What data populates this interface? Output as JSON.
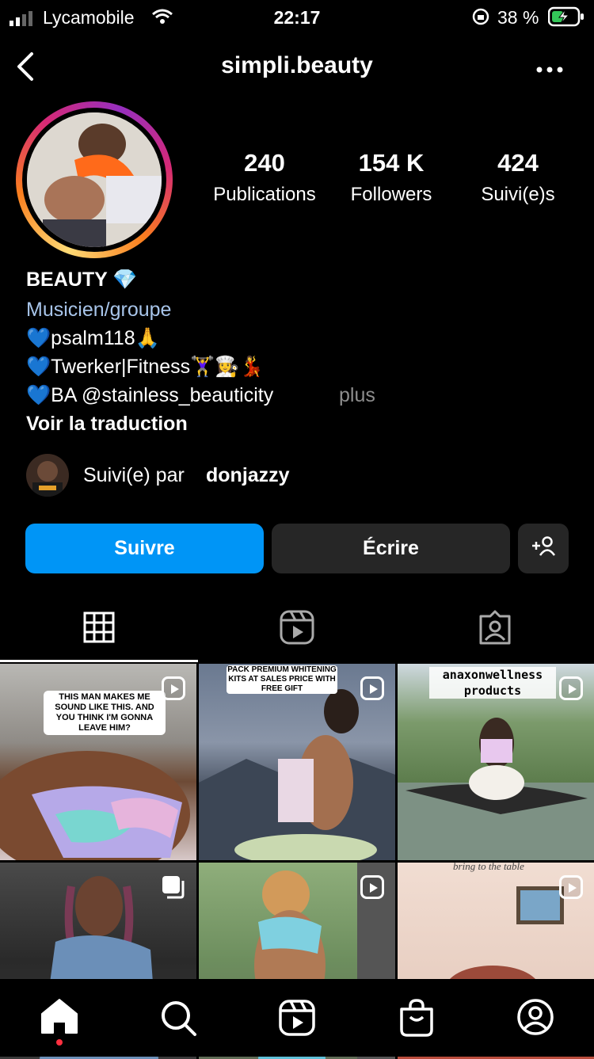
{
  "status_bar": {
    "carrier": "Lycamobile",
    "time": "22:17",
    "battery_percent": "38 %"
  },
  "header": {
    "username": "simpli.beauty"
  },
  "stats": [
    {
      "value": "240",
      "label": "Publications"
    },
    {
      "value": "154 K",
      "label": "Followers"
    },
    {
      "value": "424",
      "label": "Suivi(e)s"
    }
  ],
  "bio": {
    "name": "BEAUTY 💎",
    "category": "Musicien/groupe",
    "lines": [
      "💙psalm118🙏",
      "💙Twerker|Fitness🏋️‍♀️👩‍🍳💃",
      "💙BA @stainless_beauticity"
    ],
    "more": "plus",
    "translate": "Voir la traduction"
  },
  "followed_by": {
    "prefix": "Suivi(e) par",
    "user": "donjazzy"
  },
  "actions": {
    "follow": "Suivre",
    "message": "Écrire",
    "suggest_icon": "add-person-icon"
  },
  "posts": [
    {
      "caption": "THIS MAN MAKES ME SOUND LIKE THIS. AND YOU THINK I'M GONNA LEAVE HIM?",
      "type": "reel"
    },
    {
      "caption": "PACK PREMIUM WHITENING KITS AT SALES PRICE WITH FREE GIFT",
      "type": "reel"
    },
    {
      "caption": "anaxonwellness products",
      "type": "reel"
    },
    {
      "caption": "",
      "type": "carousel"
    },
    {
      "caption": "",
      "type": "reel"
    },
    {
      "caption": "bring to the table",
      "type": "reel"
    }
  ],
  "colors": {
    "accent": "#0095f6",
    "secondary_button": "#262626",
    "notification_dot": "#ff3040"
  }
}
